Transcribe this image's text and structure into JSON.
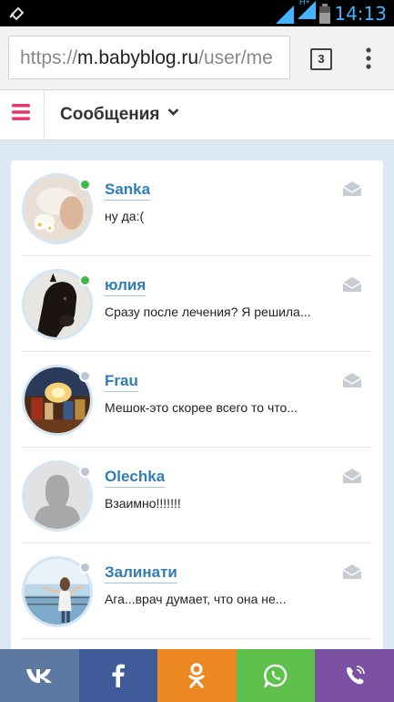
{
  "status_bar": {
    "time": "14:13",
    "network_label": "H+"
  },
  "browser": {
    "url_scheme": "https://",
    "url_host": "m.babyblog.ru",
    "url_path": "/user/me",
    "tab_count": "3"
  },
  "header": {
    "title": "Сообщения"
  },
  "messages": [
    {
      "name": "Sanka",
      "snippet": "ну да:(",
      "online": true
    },
    {
      "name": "юлия",
      "snippet": "Сразу после лечения? Я решила...",
      "online": true
    },
    {
      "name": "Frau",
      "snippet": "Мешок-это скорее всего то что...",
      "online": false
    },
    {
      "name": "Olechka",
      "snippet": "Взаимно!!!!!!!",
      "online": false
    },
    {
      "name": "Залинати",
      "snippet": "Ага...врач думает, что она не...",
      "online": false
    }
  ],
  "share_buttons": [
    {
      "name": "vk",
      "color": "#5c7aa1"
    },
    {
      "name": "facebook",
      "color": "#3f5b9a"
    },
    {
      "name": "odnoklassniki",
      "color": "#ec8722"
    },
    {
      "name": "whatsapp",
      "color": "#5ec14b"
    },
    {
      "name": "viber",
      "color": "#7d51a2"
    }
  ],
  "colors": {
    "accent": "#e8336f",
    "link": "#2f7db8",
    "background": "#dbe9f5"
  }
}
